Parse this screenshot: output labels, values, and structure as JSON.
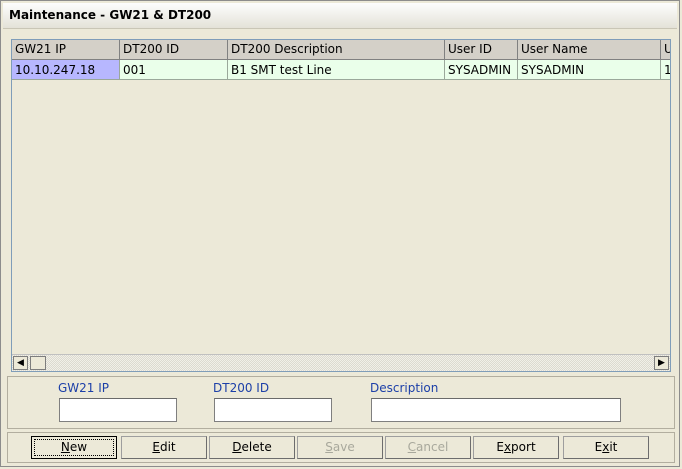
{
  "window": {
    "title": "Maintenance - GW21 & DT200"
  },
  "grid": {
    "columns": [
      {
        "label": "GW21 IP"
      },
      {
        "label": "DT200 ID"
      },
      {
        "label": "DT200 Description"
      },
      {
        "label": "User ID"
      },
      {
        "label": "User Name"
      },
      {
        "label": "U"
      }
    ],
    "rows": [
      {
        "cells": [
          "10.10.247.18",
          "001",
          "B1 SMT test Line",
          "SYSADMIN",
          "SYSADMIN",
          "1"
        ]
      }
    ]
  },
  "form": {
    "gw21_ip_label": "GW21 IP",
    "gw21_ip_value": "",
    "dt200_id_label": "DT200 ID",
    "dt200_id_value": "",
    "description_label": "Description",
    "description_value": ""
  },
  "buttons": {
    "new": {
      "pre": "",
      "accel": "N",
      "post": "ew"
    },
    "edit": {
      "pre": "",
      "accel": "E",
      "post": "dit"
    },
    "delete": {
      "pre": "",
      "accel": "D",
      "post": "elete"
    },
    "save": {
      "pre": "",
      "accel": "S",
      "post": "ave"
    },
    "cancel": {
      "pre": "",
      "accel": "C",
      "post": "ancel"
    },
    "export": {
      "pre": "E",
      "accel": "x",
      "post": "port"
    },
    "exit": {
      "pre": "E",
      "accel": "x",
      "post": "it"
    }
  },
  "icons": {
    "scroll_left": "triangle-left",
    "scroll_right": "triangle-right"
  }
}
